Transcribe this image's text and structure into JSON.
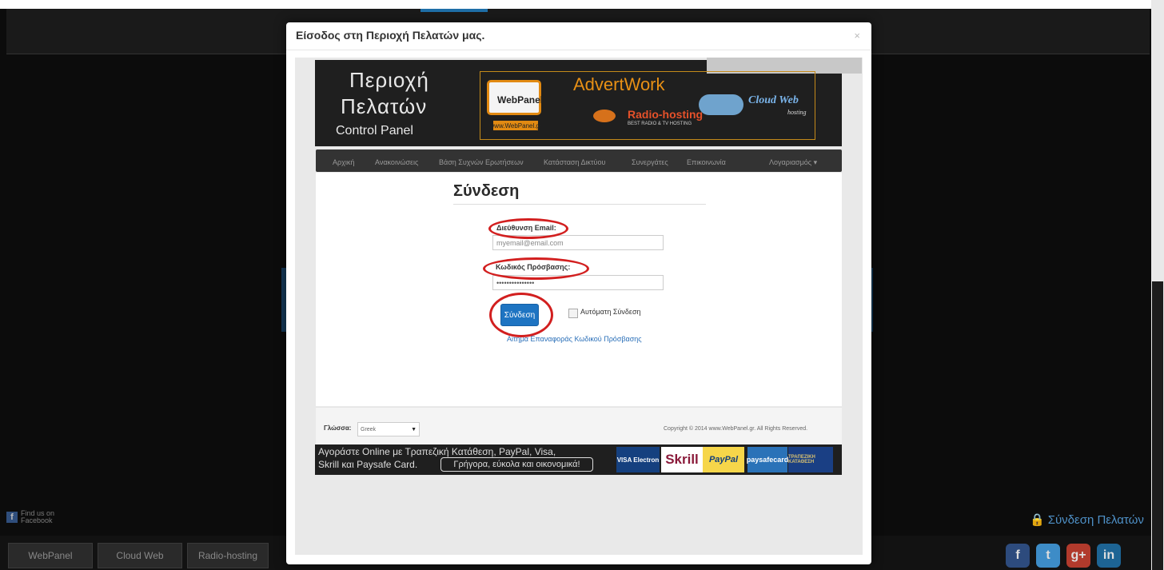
{
  "modal": {
    "title": "Είσοδος στη Περιοχή Πελατών μας.",
    "close_label": "×"
  },
  "banner": {
    "line1": "Περιοχή",
    "line2": "Πελατών",
    "line3": "Control Panel",
    "webpanel_logo": "WebPanel",
    "webpanel_url": "www.WebPanel.gr",
    "advertwork": "AdvertWork",
    "radio_hosting": "Radio-hosting",
    "radio_sub": "BEST RADIO & TV HOSTING",
    "cloud_web": "Cloud Web",
    "cloud_sub": "hosting"
  },
  "nav": {
    "items": [
      "Αρχική",
      "Ανακοινώσεις",
      "Βάση Συχνών Ερωτήσεων",
      "Κατάσταση Δικτύου",
      "Συνεργάτες",
      "Επικοινωνία",
      "Λογαριασμός ▾"
    ]
  },
  "login": {
    "title": "Σύνδεση",
    "email_label": "Διεύθυνση Email:",
    "email_value": "myemail@email.com",
    "password_label": "Κωδικός Πρόσβασης:",
    "password_value": "•••••••••••••••",
    "submit_label": "Σύνδεση",
    "remember_label": "Αυτόματη Σύνδεση",
    "forgot_link": "Αίτημα Επαναφοράς Κωδικού Πρόσβασης"
  },
  "footer": {
    "language_label": "Γλώσσα:",
    "language_value": "Greek",
    "copyright": "Copyright © 2014 www.WebPanel.gr. All Rights Reserved."
  },
  "payment": {
    "line1": "Αγοράστε Online με Τραπεζική Κατάθεση, PayPal, Visa,",
    "line2": "Skrill και Paysafe Card.",
    "tagline": "Γρήγορα, εύκολα και οικονομικά!",
    "cards": [
      "VISA Electron",
      "Skrill",
      "PayPal",
      "paysafecard",
      "ΤΡΑΠΕΖΙΚΗ ΚΑΤΑΘΕΣΗ"
    ]
  },
  "background": {
    "facebook_label": "Find us on Facebook",
    "client_login": "Σύνδεση Πελατών",
    "footer_logos": [
      "WebPanel",
      "Cloud Web",
      "Radio-hosting"
    ],
    "social": [
      "f",
      "t",
      "g+",
      "in"
    ]
  },
  "colors": {
    "accent_blue": "#1e74c2",
    "highlight_red": "#d21f1f",
    "banner_dark": "#1f1f1f"
  }
}
